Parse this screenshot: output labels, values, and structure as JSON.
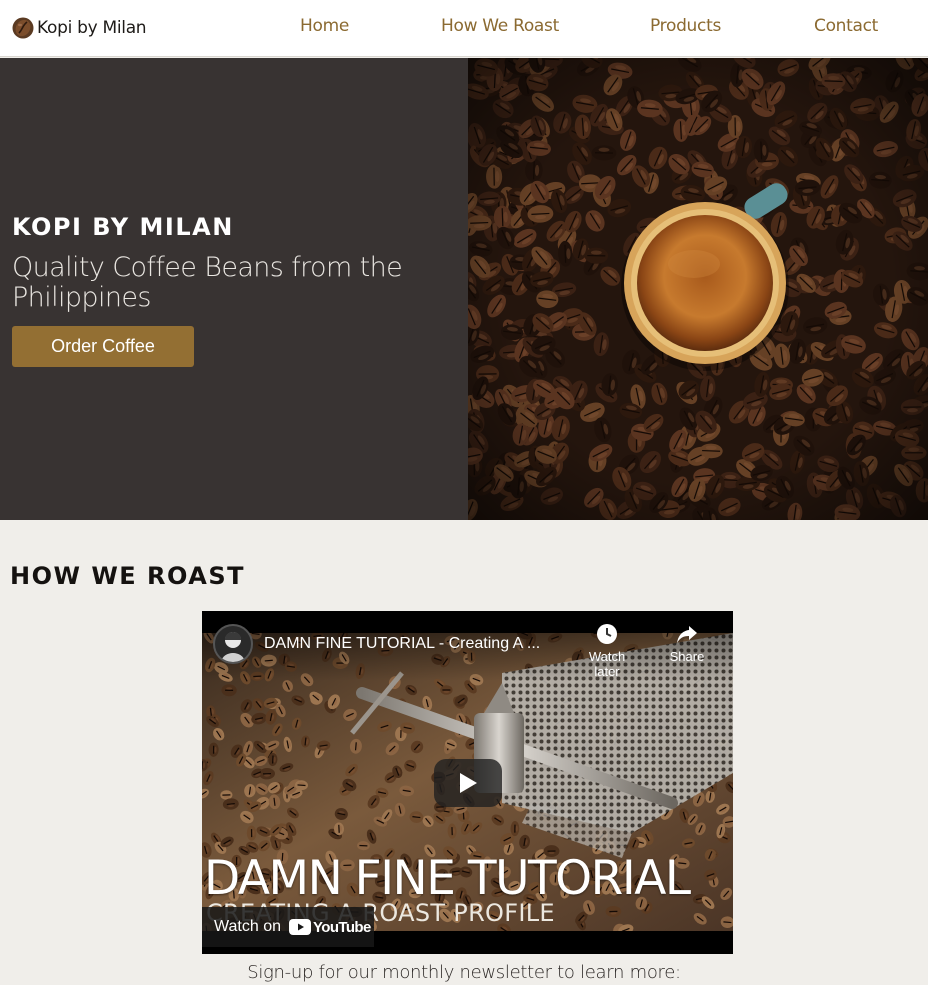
{
  "nav": {
    "brand": "Kopi by Milan",
    "links": [
      "Home",
      "How We Roast",
      "Products",
      "Contact"
    ],
    "link_color": "#8b6a31"
  },
  "hero": {
    "title": "KOPI BY MILAN",
    "subtitle": "Quality Coffee Beans from the Philippines",
    "button_label": "Order Coffee",
    "button_color": "#936f33",
    "panel_color": "#383332",
    "image": "coffee-cup-on-beans"
  },
  "roast": {
    "heading": "HOW WE ROAST",
    "video": {
      "title": "DAMN FINE TUTORIAL - Creating A ...",
      "watch_later": "Watch later",
      "share": "Share",
      "overlay_title": "DAMN FINE TUTORIAL",
      "overlay_subtitle": "CREATING A ROAST PROFILE",
      "watch_on": "Watch on",
      "platform": "YouTube"
    }
  },
  "newsletter": {
    "text": "Sign-up for our monthly newsletter to learn more:"
  }
}
